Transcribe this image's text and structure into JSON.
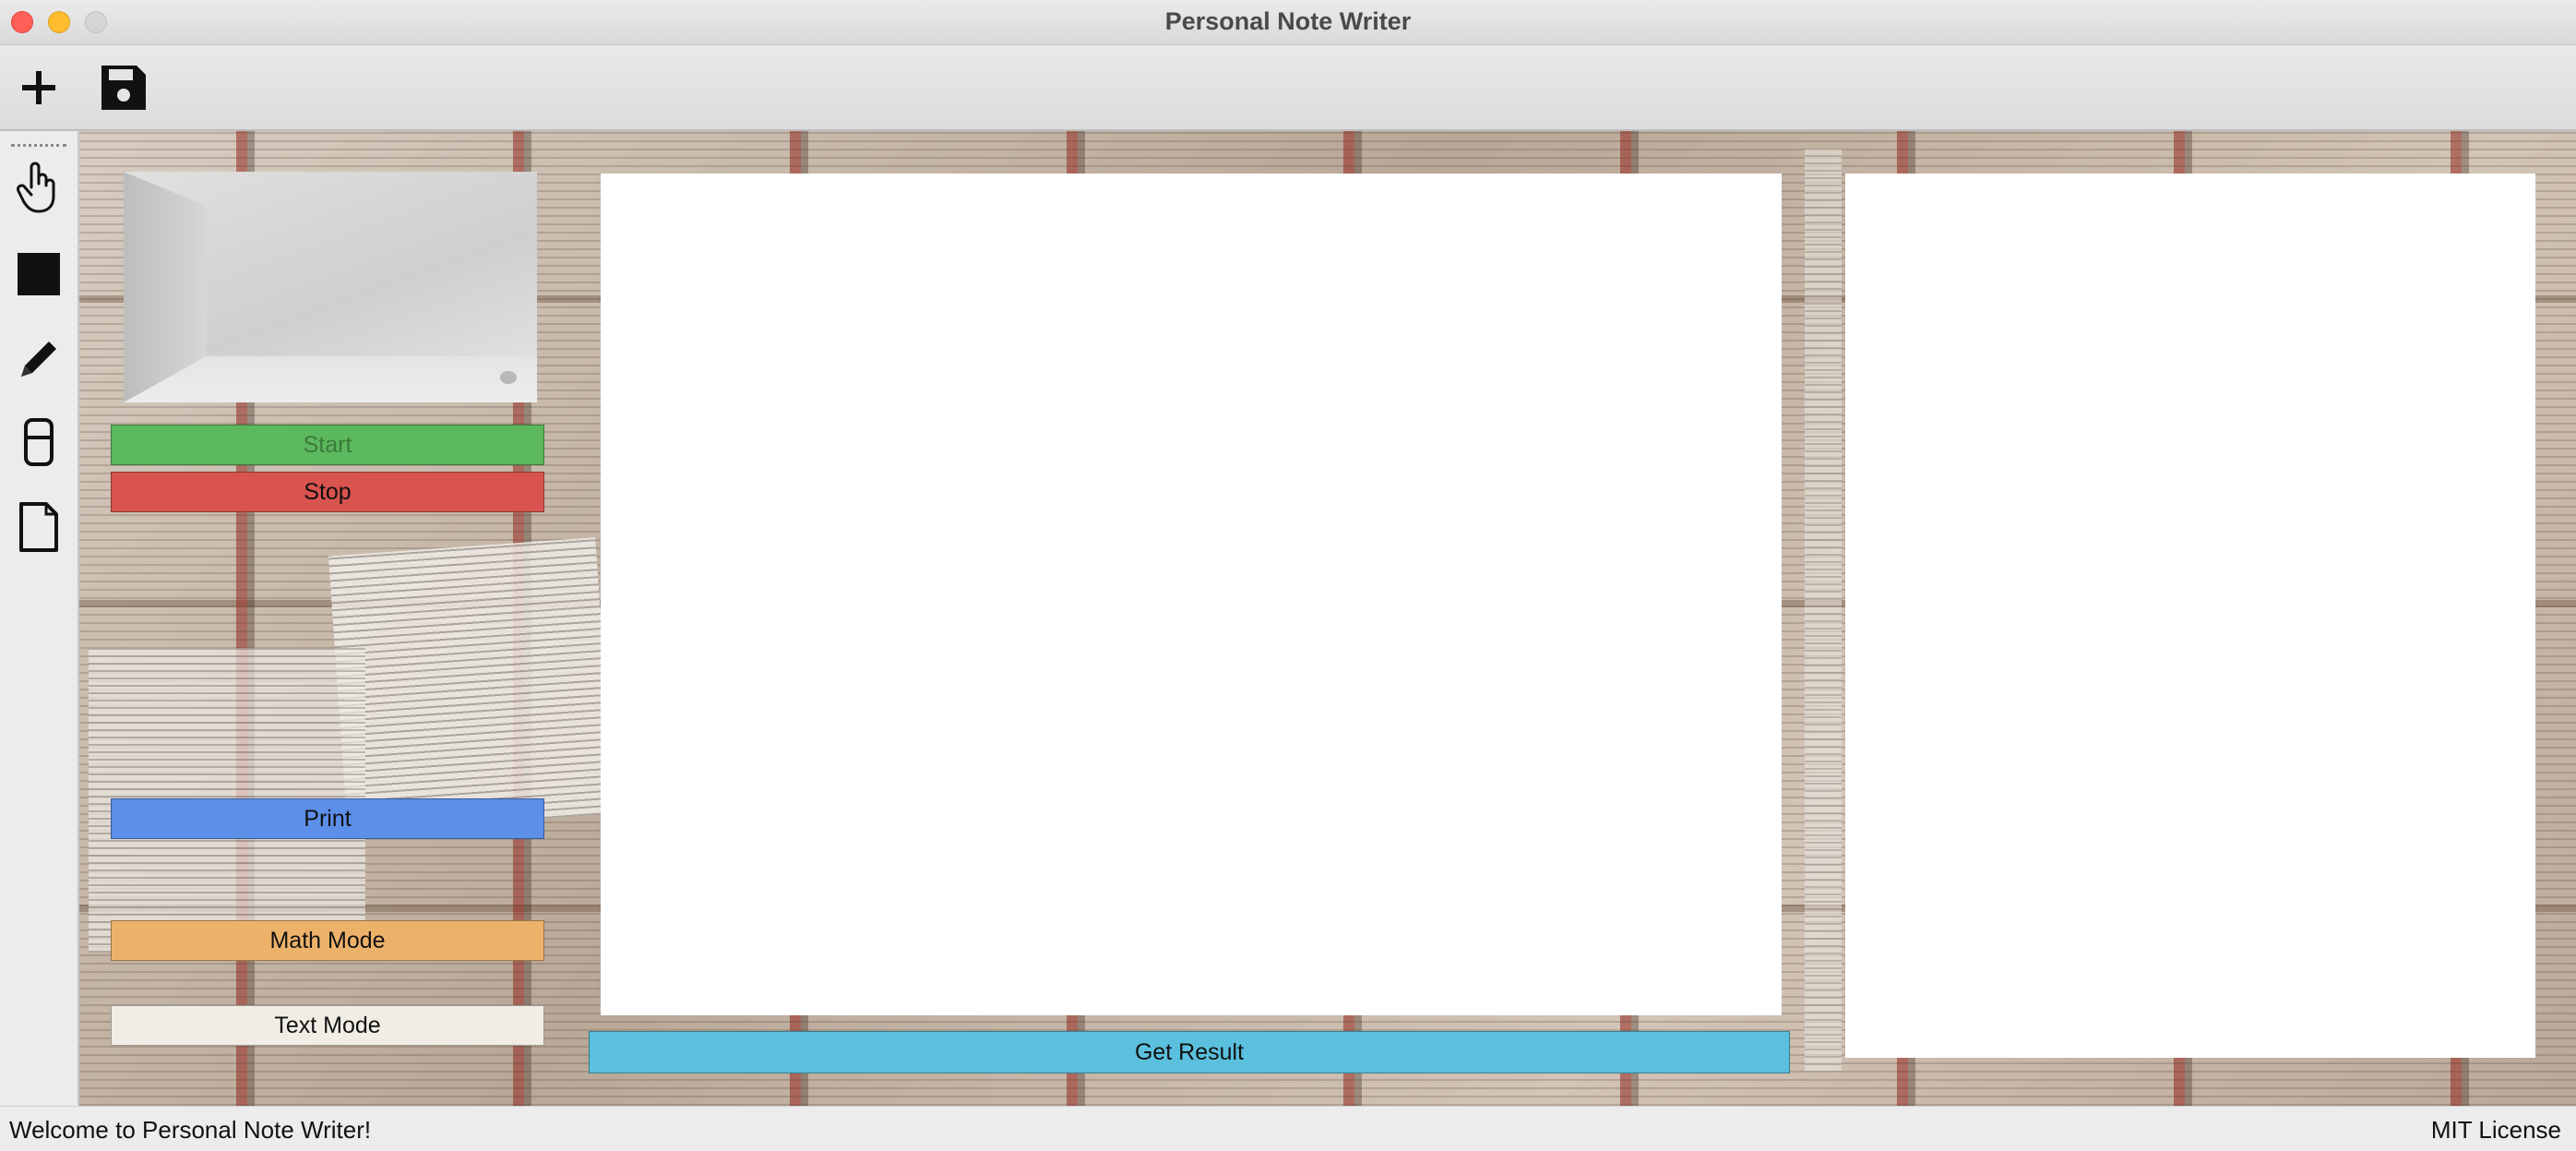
{
  "window": {
    "title": "Personal Note Writer"
  },
  "toolbar": {
    "new_icon": "plus-icon",
    "save_icon": "floppy-disk-icon"
  },
  "tools": [
    {
      "name": "hand-icon"
    },
    {
      "name": "square-icon"
    },
    {
      "name": "pencil-icon"
    },
    {
      "name": "eraser-icon"
    },
    {
      "name": "page-icon"
    }
  ],
  "left_panel": {
    "start_label": "Start",
    "stop_label": "Stop",
    "print_label": "Print",
    "math_mode_label": "Math Mode",
    "text_mode_label": "Text Mode"
  },
  "main": {
    "get_result_label": "Get Result"
  },
  "status": {
    "message": "Welcome to Personal Note Writer!",
    "license": "MIT License"
  },
  "colors": {
    "start": "#5cb85c",
    "stop": "#d9534f",
    "print": "#5b8fe8",
    "math_mode": "#ecb26a",
    "text_mode": "#f0ede4",
    "get_result": "#5bc0de"
  }
}
